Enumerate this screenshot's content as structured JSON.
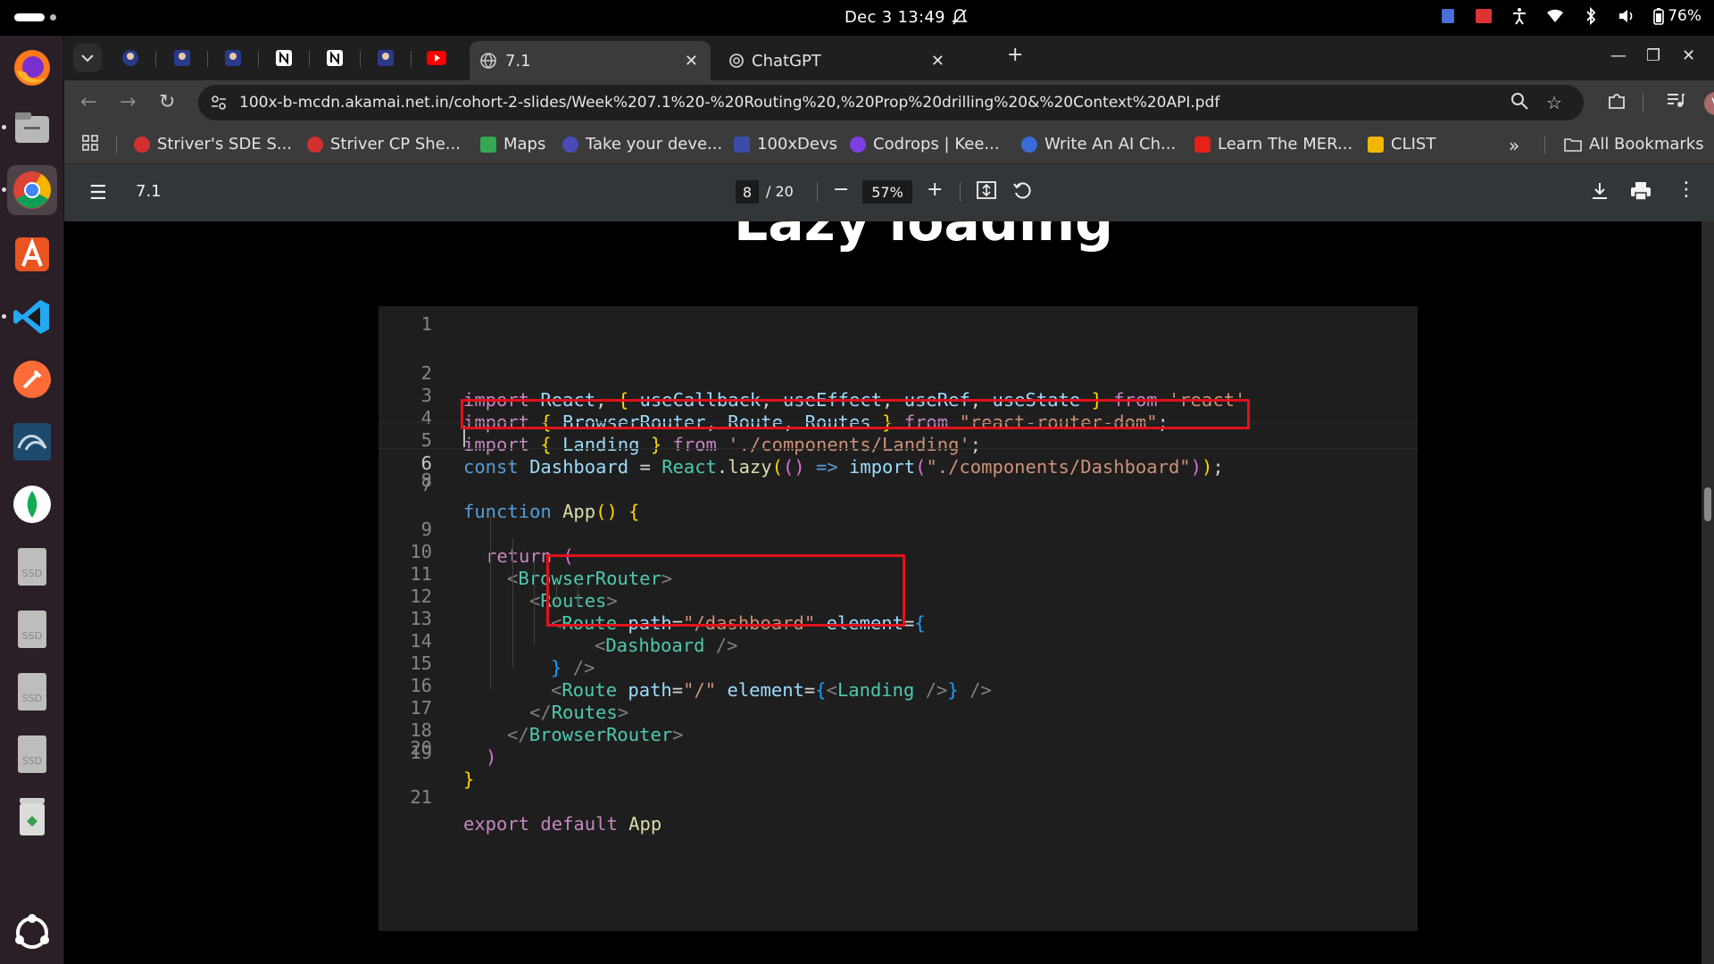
{
  "system": {
    "clock": "Dec 3  13:49",
    "battery": "76%"
  },
  "dock": {
    "apps": [
      "firefox-icon",
      "files-icon",
      "chrome-icon",
      "app-center-icon",
      "vscode-icon",
      "postman-icon",
      "mysql-workbench-icon",
      "mongodb-compass-icon",
      "ssd-drive-icon",
      "ssd-drive-icon",
      "ssd-drive-icon",
      "ssd-drive-icon",
      "trash-icon",
      "show-apps-icon"
    ]
  },
  "tabs": [
    {
      "title": "7.1",
      "active": true
    },
    {
      "title": "ChatGPT",
      "active": false
    }
  ],
  "omnibox": {
    "url": "100x-b-mcdn.akamai.net.in/cohort-2-slides/Week%207.1%20-%20Routing%20,%20Prop%20drilling%20&%20Context%20API.pdf"
  },
  "profile": {
    "initial": "V"
  },
  "bookmarks": [
    {
      "label": "Striver's SDE S...",
      "color": "#d32f2f"
    },
    {
      "label": "Striver CP She...",
      "color": "#d32f2f"
    },
    {
      "label": "Maps",
      "color": "#34a853"
    },
    {
      "label": "Take your deve...",
      "color": "#4b4bb8"
    },
    {
      "label": "100xDevs",
      "color": "#3a4ca8"
    },
    {
      "label": "Codrops | Kee...",
      "color": "#7b3fe4"
    },
    {
      "label": "Write An AI Ch...",
      "color": "#3a6bd8"
    },
    {
      "label": "Learn The MER...",
      "color": "#e62117"
    },
    {
      "label": "CLIST",
      "color": "#f2b600"
    }
  ],
  "all_bookmarks": "All Bookmarks",
  "pdf": {
    "title": "7.1",
    "page": "8",
    "total": "/ 20",
    "zoom": "57%"
  },
  "slide": {
    "title": "Lazy loading"
  },
  "code_lines": [
    "1",
    "2",
    "3",
    "4",
    "5",
    "6",
    "7",
    "8",
    "9",
    "10",
    "11",
    "12",
    "13",
    "14",
    "15",
    "16",
    "17",
    "18",
    "19",
    "20",
    "21"
  ],
  "code": {
    "l2_import": "import",
    "l2_react": "React",
    "l2_open": "{",
    "l2_hooks": [
      "useCallback",
      "useEffect",
      "useRef",
      "useState"
    ],
    "l2_close": "}",
    "l2_from": "from",
    "l2_src": "'react'",
    "l3_items": [
      "BrowserRouter",
      "Route",
      "Routes"
    ],
    "l3_src": "\"react-router-dom\"",
    "l4_item": "Landing",
    "l4_src": "'./components/Landing'",
    "l5_const": "const",
    "l5_name": "Dashboard",
    "l5_react": "React",
    "l5_lazy": "lazy",
    "l5_arrow": "=>",
    "l5_import": "import",
    "l5_src": "\"./components/Dashboard\"",
    "l7_function": "function",
    "l7_name": "App",
    "l9_return": "return",
    "tag_browser": "BrowserRouter",
    "tag_routes": "Routes",
    "tag_route": "Route",
    "attr_path": "path",
    "attr_element": "element",
    "path_dashboard": "\"/dashboard\"",
    "path_root": "\"/\"",
    "comp_dashboard": "Dashboard",
    "comp_landing": "Landing",
    "l21_export": "export",
    "l21_default": "default",
    "l21_app": "App"
  }
}
